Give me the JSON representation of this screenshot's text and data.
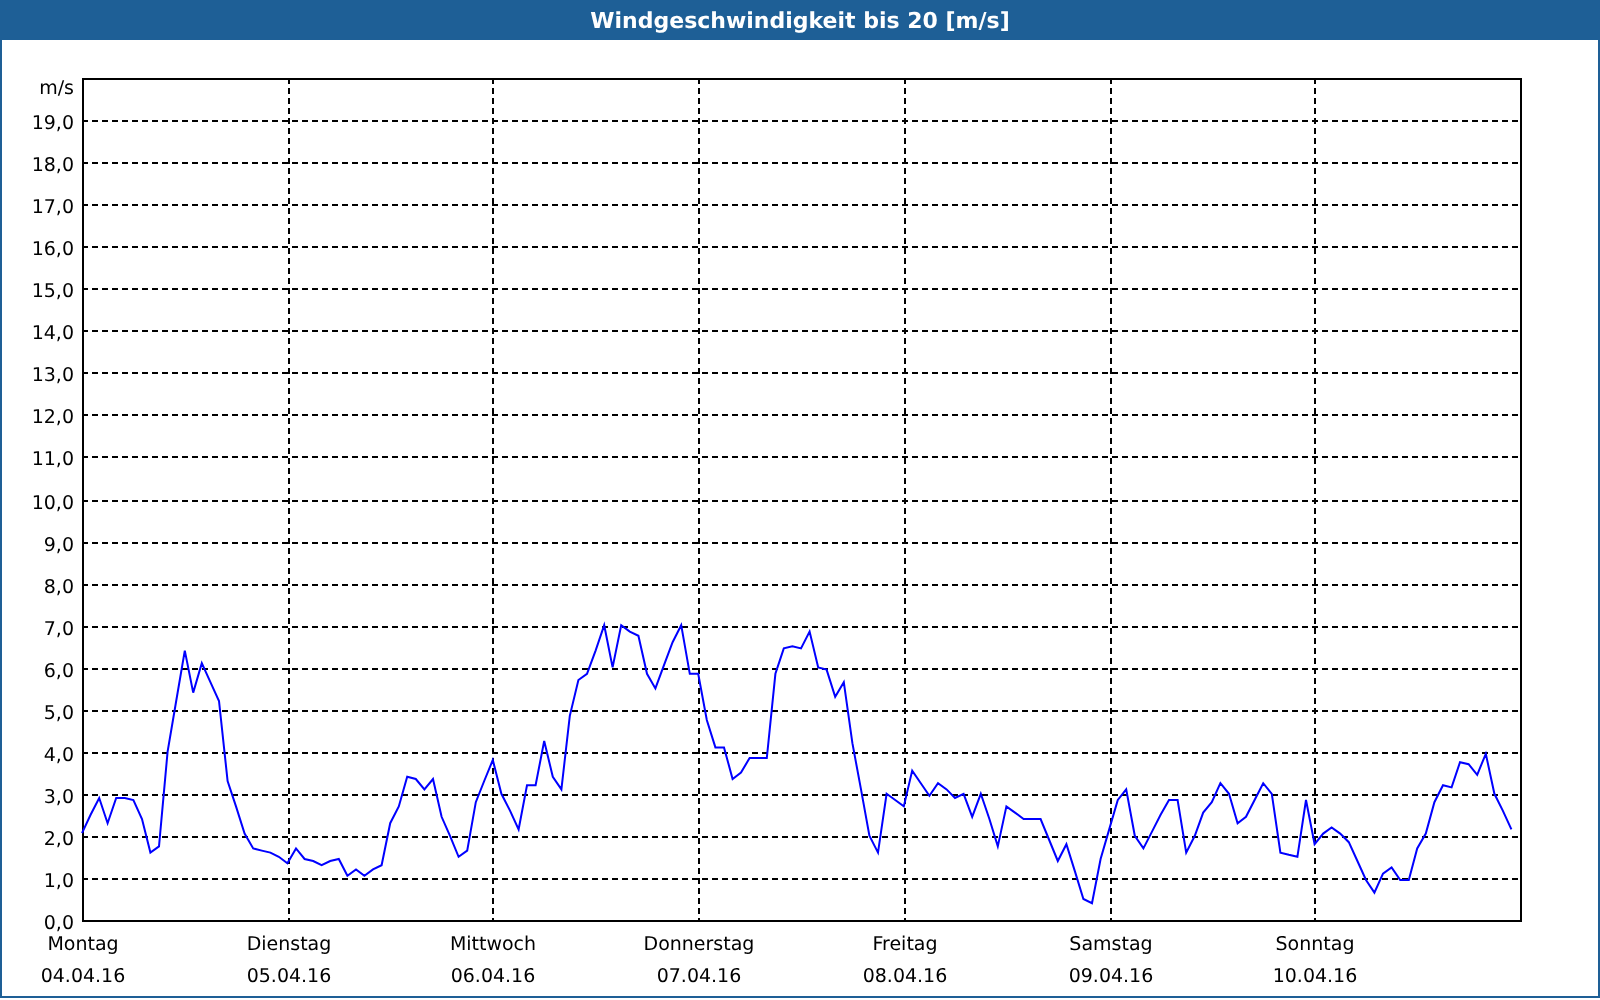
{
  "window": {
    "title": "Windgeschwindigkeit bis 20 [m/s]"
  },
  "chart_data": {
    "type": "line",
    "ylabel": "m/s",
    "ylim": [
      0,
      20
    ],
    "grid": true,
    "yticks": [
      {
        "value": 0,
        "label": "0,0"
      },
      {
        "value": 1,
        "label": "1,0"
      },
      {
        "value": 2,
        "label": "2,0"
      },
      {
        "value": 3,
        "label": "3,0"
      },
      {
        "value": 4,
        "label": "4,0"
      },
      {
        "value": 5,
        "label": "5,0"
      },
      {
        "value": 6,
        "label": "6,0"
      },
      {
        "value": 7,
        "label": "7,0"
      },
      {
        "value": 8,
        "label": "8,0"
      },
      {
        "value": 9,
        "label": "9,0"
      },
      {
        "value": 10,
        "label": "10,0"
      },
      {
        "value": 11,
        "label": "11,0"
      },
      {
        "value": 12,
        "label": "12,0"
      },
      {
        "value": 13,
        "label": "13,0"
      },
      {
        "value": 14,
        "label": "14,0"
      },
      {
        "value": 15,
        "label": "15,0"
      },
      {
        "value": 16,
        "label": "16,0"
      },
      {
        "value": 17,
        "label": "17,0"
      },
      {
        "value": 18,
        "label": "18,0"
      },
      {
        "value": 19,
        "label": "19,0"
      }
    ],
    "categories": [
      "Montag",
      null,
      null,
      null,
      null,
      null,
      null,
      null,
      null,
      null,
      null,
      null,
      null,
      null,
      null,
      null,
      null,
      null,
      null,
      null,
      null,
      null,
      null,
      null,
      "Dienstag",
      null,
      null,
      null,
      null,
      null,
      null,
      null,
      null,
      null,
      null,
      null,
      null,
      null,
      null,
      null,
      null,
      null,
      null,
      null,
      null,
      null,
      null,
      null,
      "Mittwoch",
      null,
      null,
      null,
      null,
      null,
      null,
      null,
      null,
      null,
      null,
      null,
      null,
      null,
      null,
      null,
      null,
      null,
      null,
      null,
      null,
      null,
      null,
      null,
      "Donnerstag",
      null,
      null,
      null,
      null,
      null,
      null,
      null,
      null,
      null,
      null,
      null,
      null,
      null,
      null,
      null,
      null,
      null,
      null,
      null,
      null,
      null,
      null,
      null,
      "Freitag",
      null,
      null,
      null,
      null,
      null,
      null,
      null,
      null,
      null,
      null,
      null,
      null,
      null,
      null,
      null,
      null,
      null,
      null,
      null,
      null,
      null,
      null,
      null,
      "Samstag",
      null,
      null,
      null,
      null,
      null,
      null,
      null,
      null,
      null,
      null,
      null,
      null,
      null,
      null,
      null,
      null,
      null,
      null,
      null,
      null,
      null,
      null,
      null,
      "Sonntag",
      null,
      null,
      null,
      null,
      null,
      null,
      null,
      null,
      null,
      null,
      null,
      null,
      null,
      null,
      null,
      null,
      null,
      null,
      null,
      null,
      null,
      null,
      null,
      null
    ],
    "series": [
      {
        "color": "#0000ff",
        "values": [
          2.06,
          2.5,
          2.9,
          2.3,
          2.9,
          2.9,
          2.85,
          2.4,
          1.6,
          1.75,
          4.0,
          5.2,
          6.4,
          5.4,
          6.1,
          5.65,
          5.2,
          3.3,
          2.7,
          2.05,
          1.7,
          1.65,
          1.6,
          1.5,
          1.35,
          1.7,
          1.45,
          1.4,
          1.3,
          1.4,
          1.45,
          1.05,
          1.2,
          1.05,
          1.2,
          1.3,
          2.3,
          2.7,
          3.4,
          3.35,
          3.1,
          3.35,
          2.45,
          2.0,
          1.5,
          1.65,
          2.8,
          3.3,
          3.8,
          3.0,
          2.6,
          2.15,
          3.2,
          3.2,
          4.25,
          3.4,
          3.1,
          4.85,
          5.7,
          5.85,
          6.4,
          7.0,
          6.0,
          7.0,
          6.85,
          6.75,
          5.85,
          5.5,
          6.05,
          6.6,
          7.0,
          5.85,
          5.85,
          4.75,
          4.1,
          4.1,
          3.35,
          3.5,
          3.85,
          3.85,
          3.85,
          5.85,
          6.45,
          6.5,
          6.45,
          6.85,
          6.0,
          5.95,
          5.3,
          5.65,
          4.2,
          3.1,
          2.0,
          1.6,
          3.0,
          2.85,
          2.7,
          3.55,
          3.25,
          2.95,
          3.25,
          3.1,
          2.9,
          3.0,
          2.45,
          3.0,
          2.4,
          1.75,
          2.7,
          2.55,
          2.4,
          2.4,
          2.4,
          1.9,
          1.4,
          1.8,
          1.15,
          0.5,
          0.4,
          1.45,
          2.15,
          2.85,
          3.1,
          2.0,
          1.7,
          2.1,
          2.5,
          2.85,
          2.85,
          1.6,
          2.0,
          2.55,
          2.8,
          3.25,
          3.0,
          2.3,
          2.45,
          2.85,
          3.25,
          3.0,
          1.6,
          1.55,
          1.5,
          2.85,
          1.8,
          2.05,
          2.2,
          2.05,
          1.85,
          1.4,
          0.95,
          0.65,
          1.1,
          1.25,
          0.95,
          0.95,
          1.7,
          2.05,
          2.8,
          3.2,
          3.15,
          3.75,
          3.7,
          3.45,
          3.95,
          3.0,
          2.6,
          2.15,
          null
        ]
      }
    ]
  },
  "x_axis_dates": [
    "04.04.16",
    "05.04.16",
    "06.04.16",
    "07.04.16",
    "08.04.16",
    "09.04.16",
    "10.04.16"
  ]
}
